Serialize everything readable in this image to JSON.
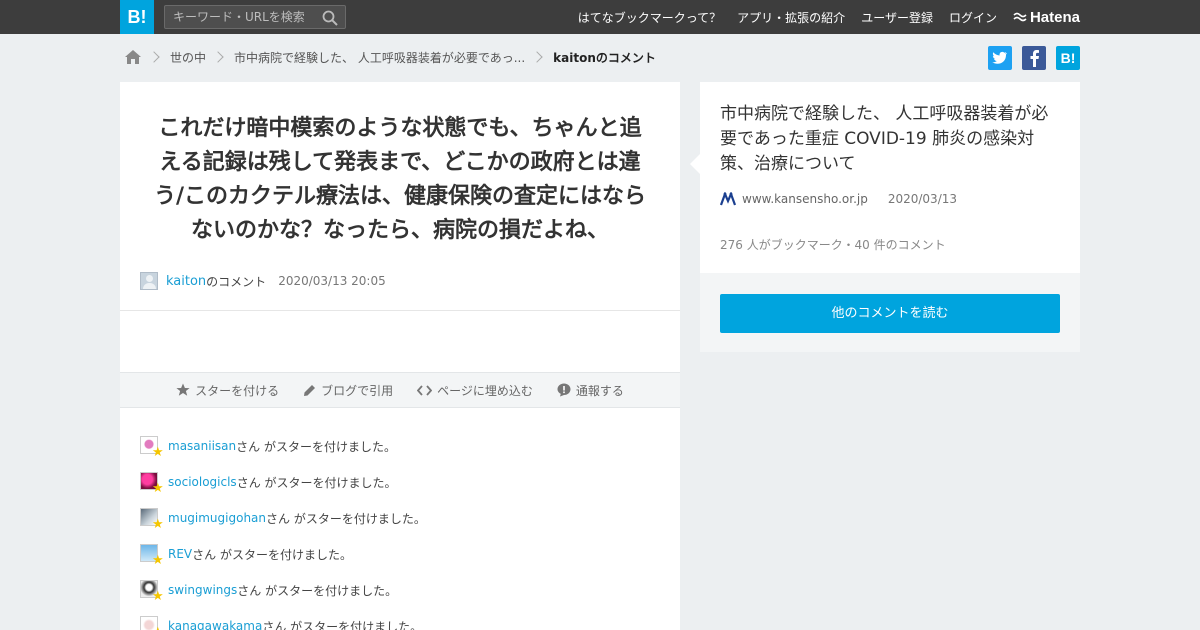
{
  "header": {
    "logo": "B!",
    "search_placeholder": "キーワード・URLを検索",
    "nav": [
      "はてなブックマークって？",
      "アプリ・拡張の紹介",
      "ユーザー登録",
      "ログイン"
    ],
    "brand": "Hatena"
  },
  "breadcrumb": {
    "category": "世の中",
    "entry": "市中病院で経験した、 人工呼吸器装着が必要であっ...",
    "current": "kaitonのコメント"
  },
  "share": [
    "twitter-icon",
    "facebook-icon",
    "hatena-bookmark-icon"
  ],
  "colors": {
    "accent": "#00a4de",
    "link": "#1a9ed4",
    "twitter": "#1da1f2",
    "facebook": "#3b5998",
    "star": "#f5c600"
  },
  "comment": {
    "text": "これだけ暗中模索のような状態でも、ちゃんと追える記録は残して発表まで、どこかの政府とは違う/このカクテル療法は、健康保険の査定にはならないのかな？なったら、病院の損だよね、",
    "author": "kaiton",
    "author_suffix": "のコメント",
    "date": "2020/03/13 20:05"
  },
  "actions": {
    "star": "スターを付ける",
    "quote": "ブログで引用",
    "embed": "ページに埋め込む",
    "report": "通報する"
  },
  "stars": {
    "message": "さん がスターを付けました。",
    "users": [
      "masaniisan",
      "sociologicls",
      "mugimugigohan",
      "REV",
      "swingwings",
      "kanagawakama"
    ]
  },
  "entry": {
    "title": "市中病院で経験した、 人工呼吸器装着が必要であった重症 COVID-19 肺炎の感染対策、治療について",
    "domain": "www.kansensho.or.jp",
    "date": "2020/03/13",
    "counts": "276 人がブックマーク・40 件のコメント",
    "button": "他のコメントを読む"
  }
}
